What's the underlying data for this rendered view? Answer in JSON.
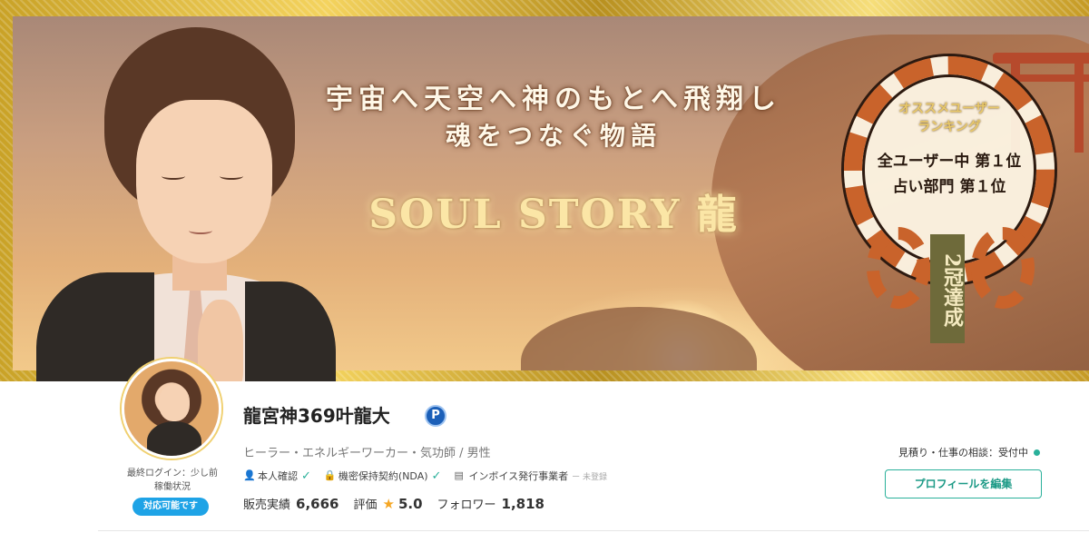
{
  "banner": {
    "headline_line1": "宇宙へ天空へ神のもとへ飛翔し",
    "headline_line2": "魂をつなぐ物語",
    "headline_line3": "SOUL STORY 龍",
    "badge_title_1": "オススメユーザー",
    "badge_title_2": "ランキング",
    "rank_all": "全ユーザー中 第１位",
    "rank_fortune": "占い部門 第１位",
    "crown_label": "2冠達成"
  },
  "profile": {
    "name": "龍宮神369叶龍大",
    "pro_badge": "P",
    "job": "ヒーラー・エネルギーワーカー・気功師 / 男性",
    "last_login": "最終ログイン：少し前",
    "operation_status": "稼働状況",
    "status_badge": "対応可能です",
    "verifications": [
      {
        "label": "本人確認",
        "icon": "person-icon",
        "state": "✓"
      },
      {
        "label": "機密保持契約(NDA)",
        "icon": "lock-icon",
        "state": "✓"
      },
      {
        "label": "インボイス発行事業者",
        "icon": "document-icon",
        "state": "ー 未登録"
      }
    ],
    "stats": {
      "sales_label": "販売実績",
      "sales_value": "6,666",
      "rating_label": "評価",
      "rating_value": "5.0",
      "followers_label": "フォロワー",
      "followers_value": "1,818"
    },
    "consult_status": "見積り・仕事の相談：受付中",
    "edit_button": "プロフィールを編集"
  },
  "colors": {
    "accent": "#29b09a",
    "status_blue": "#1ea3e6",
    "star": "#f5a623"
  }
}
